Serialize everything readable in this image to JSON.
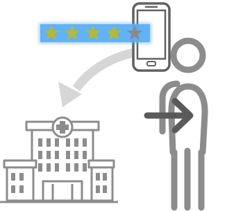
{
  "rating": {
    "filled": 4,
    "total": 5
  },
  "colors": {
    "background": "#ffffff",
    "rating_bar": "#5aaef6",
    "star_filled": "#b4b93a",
    "star_empty": "#8a8a8a",
    "icon_gray": "#8c8c8c",
    "icon_dark": "#606060",
    "arrow_light": "#d6d6d6"
  },
  "icons": {
    "phone": "smartphone-icon",
    "rating": "star-rating-icon",
    "hospital": "hospital-building-icon",
    "person": "person-icon",
    "enter_arrow": "arrow-right-icon",
    "curved_arrow": "curved-arrow-icon"
  }
}
